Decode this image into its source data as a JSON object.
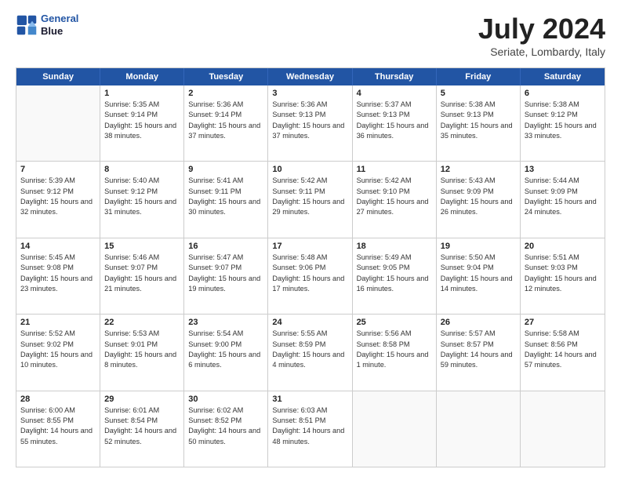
{
  "logo": {
    "line1": "General",
    "line2": "Blue"
  },
  "title": "July 2024",
  "subtitle": "Seriate, Lombardy, Italy",
  "header_days": [
    "Sunday",
    "Monday",
    "Tuesday",
    "Wednesday",
    "Thursday",
    "Friday",
    "Saturday"
  ],
  "weeks": [
    [
      {
        "day": "",
        "empty": true
      },
      {
        "day": "1",
        "sunrise": "5:35 AM",
        "sunset": "9:14 PM",
        "daylight": "15 hours and 38 minutes."
      },
      {
        "day": "2",
        "sunrise": "5:36 AM",
        "sunset": "9:14 PM",
        "daylight": "15 hours and 37 minutes."
      },
      {
        "day": "3",
        "sunrise": "5:36 AM",
        "sunset": "9:13 PM",
        "daylight": "15 hours and 37 minutes."
      },
      {
        "day": "4",
        "sunrise": "5:37 AM",
        "sunset": "9:13 PM",
        "daylight": "15 hours and 36 minutes."
      },
      {
        "day": "5",
        "sunrise": "5:38 AM",
        "sunset": "9:13 PM",
        "daylight": "15 hours and 35 minutes."
      },
      {
        "day": "6",
        "sunrise": "5:38 AM",
        "sunset": "9:12 PM",
        "daylight": "15 hours and 33 minutes."
      }
    ],
    [
      {
        "day": "7",
        "sunrise": "5:39 AM",
        "sunset": "9:12 PM",
        "daylight": "15 hours and 32 minutes."
      },
      {
        "day": "8",
        "sunrise": "5:40 AM",
        "sunset": "9:12 PM",
        "daylight": "15 hours and 31 minutes."
      },
      {
        "day": "9",
        "sunrise": "5:41 AM",
        "sunset": "9:11 PM",
        "daylight": "15 hours and 30 minutes."
      },
      {
        "day": "10",
        "sunrise": "5:42 AM",
        "sunset": "9:11 PM",
        "daylight": "15 hours and 29 minutes."
      },
      {
        "day": "11",
        "sunrise": "5:42 AM",
        "sunset": "9:10 PM",
        "daylight": "15 hours and 27 minutes."
      },
      {
        "day": "12",
        "sunrise": "5:43 AM",
        "sunset": "9:09 PM",
        "daylight": "15 hours and 26 minutes."
      },
      {
        "day": "13",
        "sunrise": "5:44 AM",
        "sunset": "9:09 PM",
        "daylight": "15 hours and 24 minutes."
      }
    ],
    [
      {
        "day": "14",
        "sunrise": "5:45 AM",
        "sunset": "9:08 PM",
        "daylight": "15 hours and 23 minutes."
      },
      {
        "day": "15",
        "sunrise": "5:46 AM",
        "sunset": "9:07 PM",
        "daylight": "15 hours and 21 minutes."
      },
      {
        "day": "16",
        "sunrise": "5:47 AM",
        "sunset": "9:07 PM",
        "daylight": "15 hours and 19 minutes."
      },
      {
        "day": "17",
        "sunrise": "5:48 AM",
        "sunset": "9:06 PM",
        "daylight": "15 hours and 17 minutes."
      },
      {
        "day": "18",
        "sunrise": "5:49 AM",
        "sunset": "9:05 PM",
        "daylight": "15 hours and 16 minutes."
      },
      {
        "day": "19",
        "sunrise": "5:50 AM",
        "sunset": "9:04 PM",
        "daylight": "15 hours and 14 minutes."
      },
      {
        "day": "20",
        "sunrise": "5:51 AM",
        "sunset": "9:03 PM",
        "daylight": "15 hours and 12 minutes."
      }
    ],
    [
      {
        "day": "21",
        "sunrise": "5:52 AM",
        "sunset": "9:02 PM",
        "daylight": "15 hours and 10 minutes."
      },
      {
        "day": "22",
        "sunrise": "5:53 AM",
        "sunset": "9:01 PM",
        "daylight": "15 hours and 8 minutes."
      },
      {
        "day": "23",
        "sunrise": "5:54 AM",
        "sunset": "9:00 PM",
        "daylight": "15 hours and 6 minutes."
      },
      {
        "day": "24",
        "sunrise": "5:55 AM",
        "sunset": "8:59 PM",
        "daylight": "15 hours and 4 minutes."
      },
      {
        "day": "25",
        "sunrise": "5:56 AM",
        "sunset": "8:58 PM",
        "daylight": "15 hours and 1 minute."
      },
      {
        "day": "26",
        "sunrise": "5:57 AM",
        "sunset": "8:57 PM",
        "daylight": "14 hours and 59 minutes."
      },
      {
        "day": "27",
        "sunrise": "5:58 AM",
        "sunset": "8:56 PM",
        "daylight": "14 hours and 57 minutes."
      }
    ],
    [
      {
        "day": "28",
        "sunrise": "6:00 AM",
        "sunset": "8:55 PM",
        "daylight": "14 hours and 55 minutes."
      },
      {
        "day": "29",
        "sunrise": "6:01 AM",
        "sunset": "8:54 PM",
        "daylight": "14 hours and 52 minutes."
      },
      {
        "day": "30",
        "sunrise": "6:02 AM",
        "sunset": "8:52 PM",
        "daylight": "14 hours and 50 minutes."
      },
      {
        "day": "31",
        "sunrise": "6:03 AM",
        "sunset": "8:51 PM",
        "daylight": "14 hours and 48 minutes."
      },
      {
        "day": "",
        "empty": true
      },
      {
        "day": "",
        "empty": true
      },
      {
        "day": "",
        "empty": true
      }
    ]
  ]
}
